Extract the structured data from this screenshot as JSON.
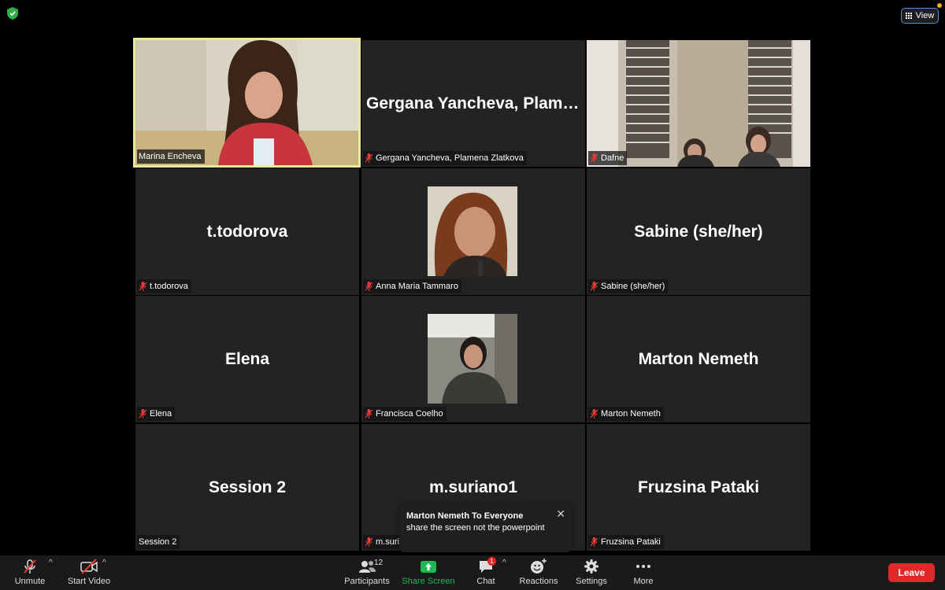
{
  "window": {
    "view_label": "View"
  },
  "tiles": [
    {
      "name": "Marina Encheva",
      "big": "",
      "muted": false
    },
    {
      "name": "Gergana Yancheva, Plamena Zlatkova",
      "big": "Gergana Yancheva, Plame...",
      "muted": true
    },
    {
      "name": "Dafne",
      "big": "",
      "muted": true
    },
    {
      "name": "t.todorova",
      "big": "t.todorova",
      "muted": true
    },
    {
      "name": "Anna Maria Tammaro",
      "big": "",
      "muted": true
    },
    {
      "name": "Sabine (she/her)",
      "big": "Sabine (she/her)",
      "muted": true
    },
    {
      "name": "Elena",
      "big": "Elena",
      "muted": true
    },
    {
      "name": "Francisca Coelho",
      "big": "",
      "muted": true
    },
    {
      "name": "Marton Nemeth",
      "big": "Marton Nemeth",
      "muted": true
    },
    {
      "name": "Session 2",
      "big": "Session 2",
      "muted": false
    },
    {
      "name": "m.surian",
      "big": "m.suriano1",
      "muted": true
    },
    {
      "name": "Fruzsina Pataki",
      "big": "Fruzsina Pataki",
      "muted": true
    }
  ],
  "chat_popup": {
    "from": "Marton Nemeth To Everyone",
    "message": "share the screen not the powerpoint"
  },
  "toolbar": {
    "unmute": "Unmute",
    "start_video": "Start Video",
    "participants": "Participants",
    "participants_count": "12",
    "share_screen": "Share Screen",
    "chat": "Chat",
    "chat_badge": "1",
    "reactions": "Reactions",
    "settings": "Settings",
    "more": "More",
    "leave": "Leave"
  },
  "colors": {
    "active_speaker_border": "#e8e99a",
    "share_green": "#1db954",
    "leave_red": "#e02828",
    "tile_bg": "#232323"
  }
}
